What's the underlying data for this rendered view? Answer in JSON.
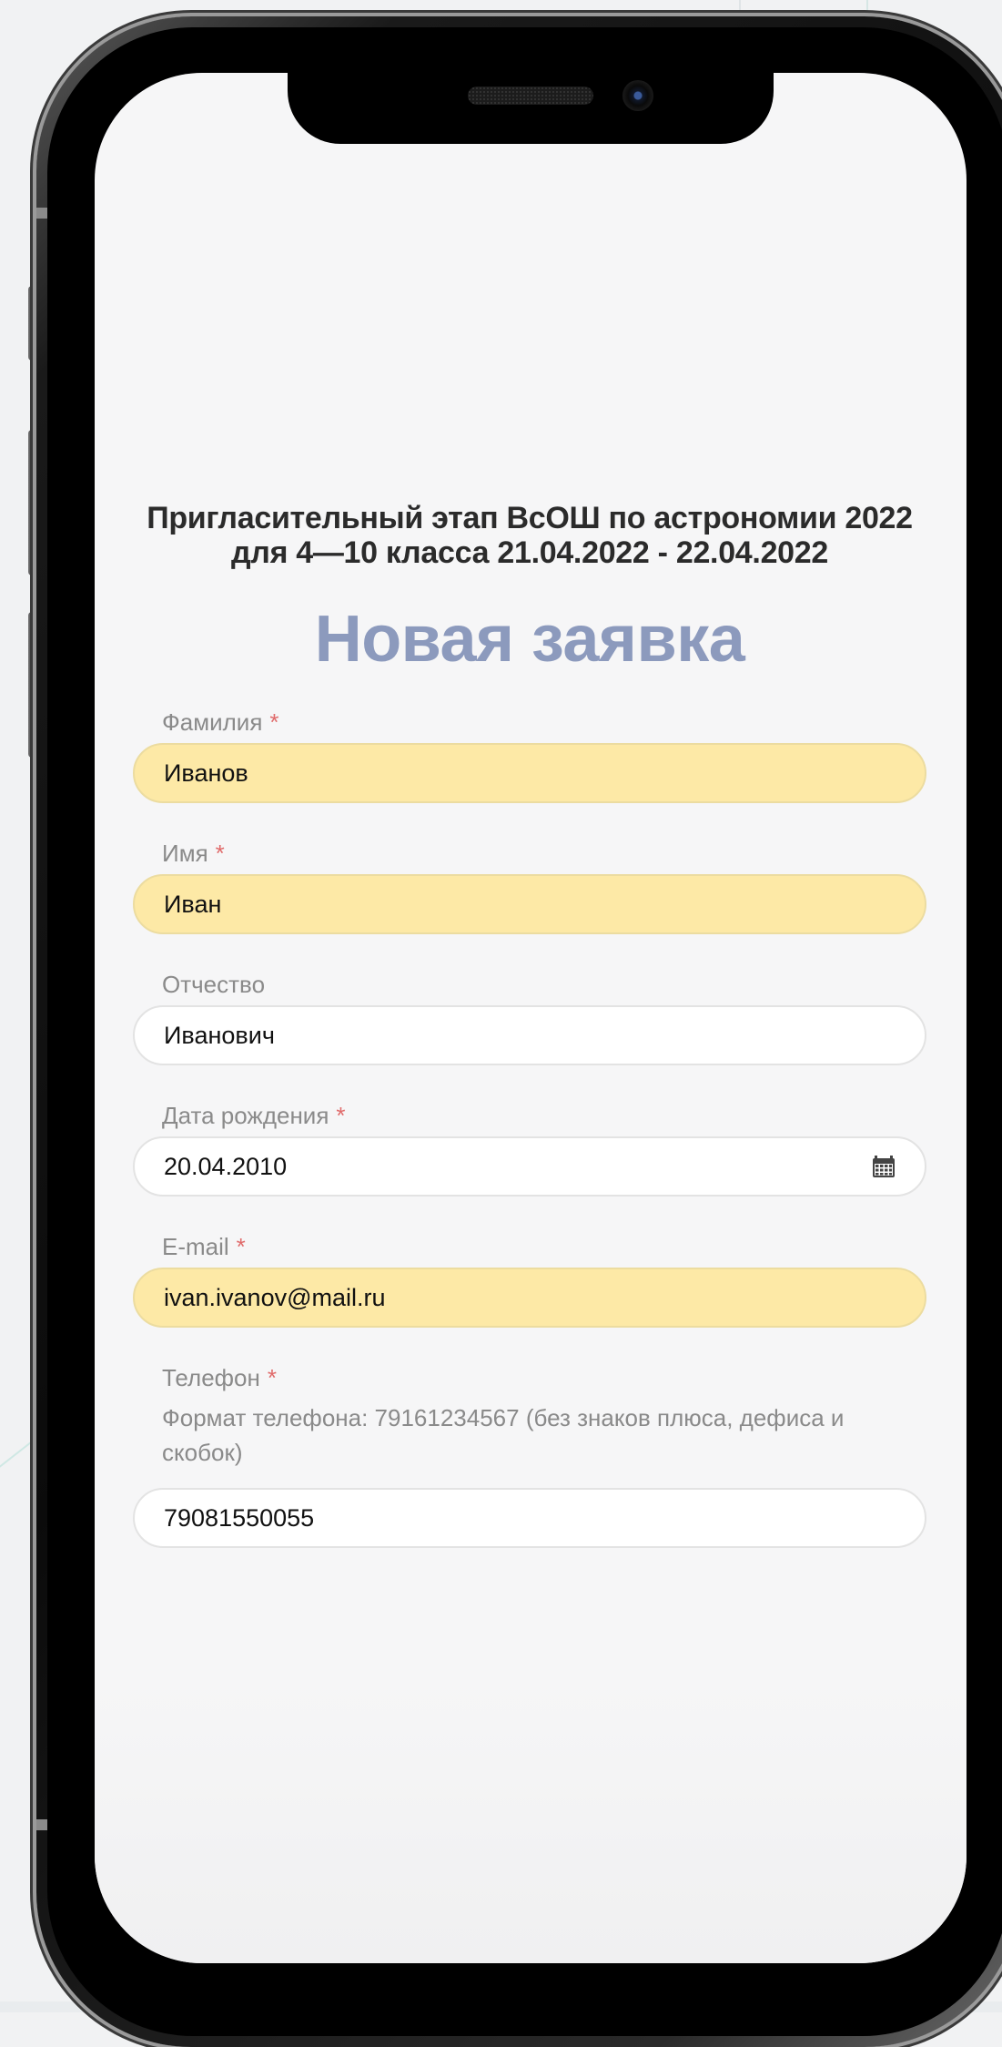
{
  "event_title_line1": "Пригласительный этап ВсОШ по астрономии 2022",
  "event_title_line2": "для 4—10 класса 21.04.2022 - 22.04.2022",
  "page_title": "Новая заявка",
  "required_marker": "*",
  "colors": {
    "title_accent": "#8c9abd",
    "autofill_bg": "#fde9a6",
    "required": "#e06b6b"
  },
  "form": {
    "last_name": {
      "label": "Фамилия",
      "value": "Иванов"
    },
    "first_name": {
      "label": "Имя",
      "value": "Иван"
    },
    "middle_name": {
      "label": "Отчество",
      "value": "Иванович"
    },
    "birth_date": {
      "label": "Дата рождения",
      "value": "20.04.2010",
      "icon": "calendar-icon"
    },
    "email": {
      "label": "E-mail",
      "value": "ivan.ivanov@mail.ru"
    },
    "phone": {
      "label": "Телефон",
      "hint": "Формат телефона: 79161234567 (без знаков плюса, дефиса и скобок)",
      "value": "79081550055"
    }
  }
}
